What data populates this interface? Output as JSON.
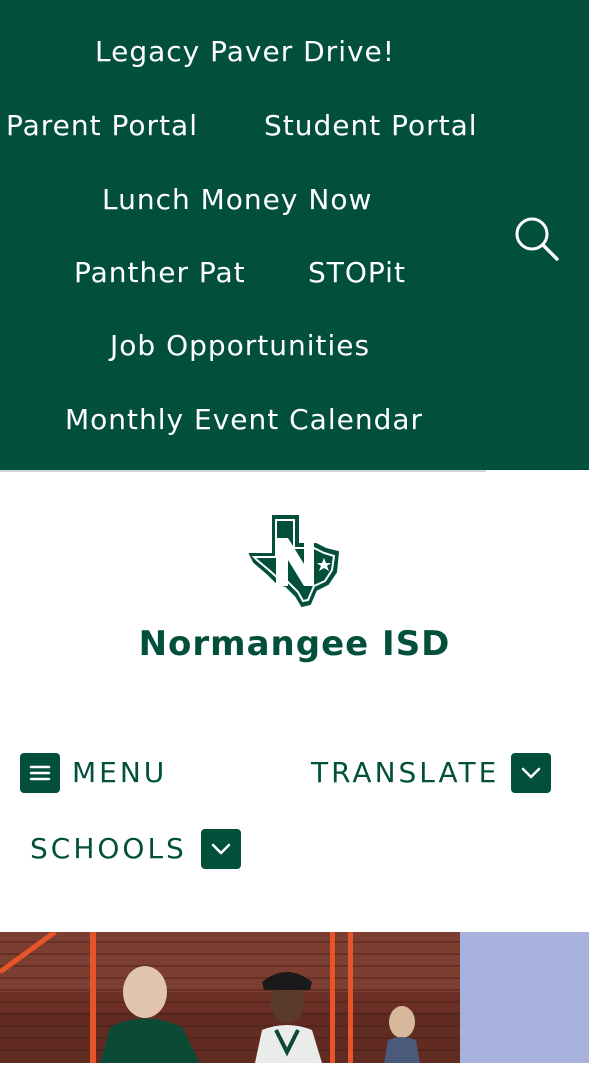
{
  "utility_nav": {
    "links": [
      {
        "label": "Legacy Paver Drive!"
      },
      {
        "label": "Parent Portal"
      },
      {
        "label": "Student Portal"
      },
      {
        "label": "Lunch Money Now"
      },
      {
        "label": "Panther Pat"
      },
      {
        "label": "STOPit"
      },
      {
        "label": "Job Opportunities"
      },
      {
        "label": "Monthly Event Calendar"
      }
    ],
    "search_icon": "magnifier-icon"
  },
  "header": {
    "logo_icon": "texas-n-logo-icon",
    "title": "Normangee ISD"
  },
  "nav": {
    "menu_label": "MENU",
    "menu_icon": "hamburger-icon",
    "translate_label": "TRANSLATE",
    "schools_label": "SCHOOLS",
    "dropdown_icon": "chevron-down-icon"
  },
  "colors": {
    "brand_green": "#02503c",
    "text_white": "#ffffff",
    "hero_side": "#a6b1dc"
  }
}
